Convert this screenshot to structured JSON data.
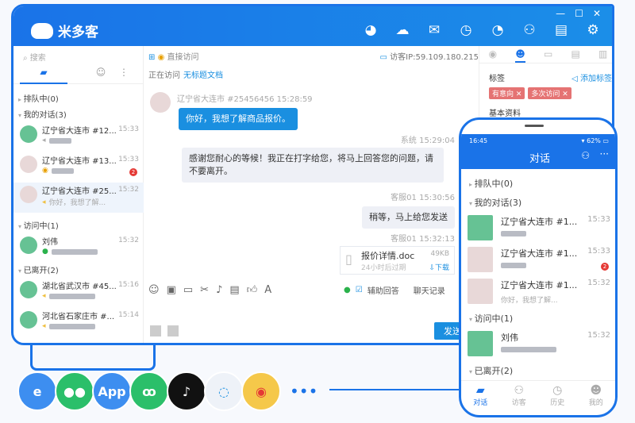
{
  "app": {
    "name": "米多客"
  },
  "toolbar": {
    "icons": [
      "dashboard-icon",
      "cloud-icon",
      "mail-icon",
      "clock-icon",
      "chart-icon",
      "team-icon",
      "calendar-icon",
      "settings-icon"
    ]
  },
  "left": {
    "search_placeholder": "搜索",
    "groups": {
      "queue": "排队中(0)",
      "mine": "我的对话(3)",
      "visiting": "访问中(1)",
      "left": "已离开(2)"
    },
    "mine": [
      {
        "name": "辽宁省大连市 #12...",
        "time": "15:33",
        "preview": ""
      },
      {
        "name": "辽宁省大连市 #13...",
        "time": "15:33",
        "preview": "",
        "badge": "2"
      },
      {
        "name": "辽宁省大连市 #25...",
        "time": "15:32",
        "preview": "你好，我想了解..."
      }
    ],
    "visiting": [
      {
        "name": "刘伟",
        "time": "15:32"
      }
    ],
    "left_list": [
      {
        "name": "湖北省武汉市 #45...",
        "time": "15:16"
      },
      {
        "name": "河北省石家庄市 #...",
        "time": "15:14"
      }
    ]
  },
  "chat": {
    "source": "直接访问",
    "visitor_ip": "访客IP:59.109.180.215",
    "visiting_label": "正在访问",
    "visiting_page": "无标题文档",
    "messages": [
      {
        "meta": "辽宁省大连市 #25456456 15:28:59",
        "text": "你好，我想了解商品报价。"
      },
      {
        "meta": "系统 15:29:04",
        "text": "感谢您耐心的等候！我正在打字给您，将马上回答您的问题，请不要离开。"
      },
      {
        "meta": "客服01 15:30:56",
        "text": "稍等，马上给您发送"
      },
      {
        "meta": "客服01 15:32:13",
        "file": "报价详情.doc",
        "size": "49KB",
        "expire": "24小时后过期",
        "download": "下载"
      }
    ],
    "assist": "辅助回答",
    "history": "聊天记录",
    "send": "发送"
  },
  "right": {
    "tags_label": "标签",
    "add_tag": "添加标签",
    "tags": [
      "有意向",
      "多次访问"
    ],
    "basic": "基本资料"
  },
  "phone": {
    "time": "16:45",
    "battery": "62%",
    "title": "对话",
    "groups": {
      "queue": "排队中(0)",
      "mine": "我的对话(3)",
      "visiting": "访问中(1)",
      "left": "已离开(2)"
    },
    "mine": [
      {
        "name": "辽宁省大连市 #1...",
        "time": "15:33"
      },
      {
        "name": "辽宁省大连市 #1...",
        "time": "15:33",
        "badge": "2"
      },
      {
        "name": "辽宁省大连市 #1...",
        "time": "15:32",
        "preview": "你好，我想了解..."
      }
    ],
    "visiting": [
      {
        "name": "刘伟",
        "time": "15:32"
      }
    ],
    "nav": [
      "对话",
      "访客",
      "历史",
      "我的"
    ]
  },
  "channels": [
    "IE",
    "微信",
    "App",
    "小程序",
    "抖音",
    "企业微信",
    "微博"
  ],
  "colors": {
    "primary": "#1a73e8",
    "tag": "#e57373"
  }
}
